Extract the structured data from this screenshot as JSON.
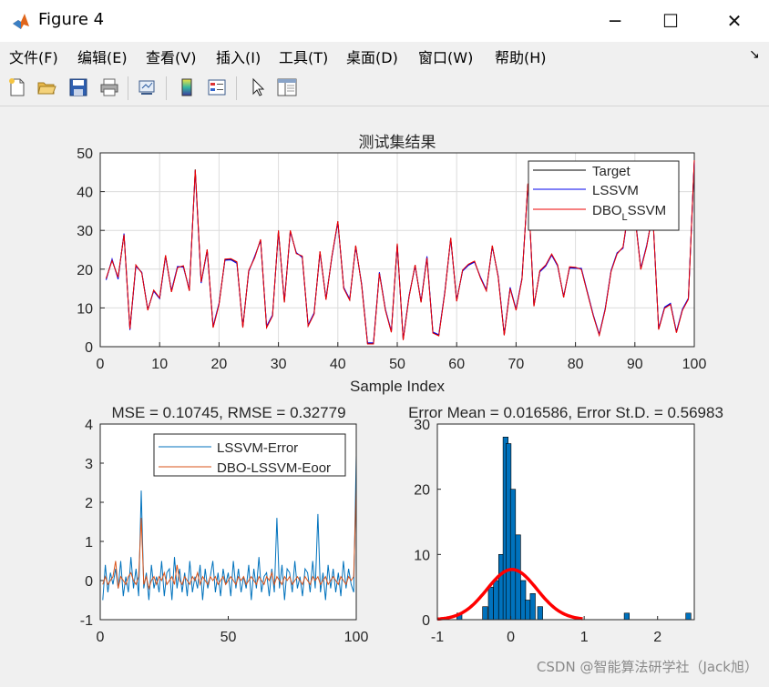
{
  "window": {
    "title": "Figure 4",
    "minimize_glyph": "─",
    "maximize_glyph": "☐",
    "close_glyph": "✕"
  },
  "menu": {
    "items": [
      "文件(F)",
      "编辑(E)",
      "查看(V)",
      "插入(I)",
      "工具(T)",
      "桌面(D)",
      "窗口(W)",
      "帮助(H)"
    ],
    "overflow_glyph": "↘"
  },
  "toolbar": {
    "icons": [
      "new-figure-icon",
      "open-file-icon",
      "save-icon",
      "print-icon",
      "link-plot-icon",
      "insert-colorbar-icon",
      "insert-legend-icon",
      "edit-plot-arrow-icon",
      "property-inspector-icon"
    ]
  },
  "watermark": "CSDN @智能算法研学社（Jack旭）",
  "chart_data": [
    {
      "type": "line",
      "title": "测试集结果",
      "xlabel": "Sample Index",
      "ylabel": "",
      "xlim": [
        0,
        100
      ],
      "ylim": [
        0,
        50
      ],
      "xticks": [
        "0",
        "10",
        "20",
        "30",
        "40",
        "50",
        "60",
        "70",
        "80",
        "90",
        "100"
      ],
      "yticks": [
        "0",
        "10",
        "20",
        "30",
        "40",
        "50"
      ],
      "grid": true,
      "legend_position": "top-right",
      "x": [
        1,
        2,
        3,
        4,
        5,
        6,
        7,
        8,
        9,
        10,
        11,
        12,
        13,
        14,
        15,
        16,
        17,
        18,
        19,
        20,
        21,
        22,
        23,
        24,
        25,
        26,
        27,
        28,
        29,
        30,
        31,
        32,
        33,
        34,
        35,
        36,
        37,
        38,
        39,
        40,
        41,
        42,
        43,
        44,
        45,
        46,
        47,
        48,
        49,
        50,
        51,
        52,
        53,
        54,
        55,
        56,
        57,
        58,
        59,
        60,
        61,
        62,
        63,
        64,
        65,
        66,
        67,
        68,
        69,
        70,
        71,
        72,
        73,
        74,
        75,
        76,
        77,
        78,
        79,
        80,
        81,
        82,
        83,
        84,
        85,
        86,
        87,
        88,
        89,
        90,
        91,
        92,
        93,
        94,
        95,
        96,
        97,
        98,
        99,
        100
      ],
      "series": [
        {
          "name": "Target",
          "color": "#000000",
          "values": [
            17.5,
            22.3,
            17.8,
            29,
            4.5,
            21,
            19.1,
            9.5,
            14.5,
            12.5,
            23.5,
            14.2,
            20.5,
            20.8,
            14.5,
            45.7,
            16.6,
            25,
            5,
            11,
            22.5,
            22.6,
            21.8,
            5,
            19.6,
            23,
            27.6,
            5,
            8,
            29.9,
            11.5,
            29.9,
            24.1,
            23.3,
            5.4,
            8.5,
            24.5,
            12.2,
            23.3,
            32.3,
            15.1,
            12.1,
            26,
            16,
            0.8,
            0.8,
            19,
            9.5,
            3.8,
            26.5,
            1.8,
            13,
            21,
            11.5,
            23,
            3.6,
            2.9,
            14,
            28,
            11.8,
            19.7,
            21.2,
            22,
            17.8,
            14.5,
            26,
            18,
            3,
            15.1,
            9.5,
            17.5,
            42,
            10.5,
            19.5,
            21,
            23.8,
            21,
            12.8,
            20.5,
            20.4,
            20,
            14,
            8,
            3,
            9.6,
            19.5,
            24,
            25.6,
            36,
            34,
            20,
            26,
            34.5,
            4.5,
            10,
            11,
            3.7,
            9.5,
            12.3,
            48
          ]
        },
        {
          "name": "LSSVM",
          "color": "#0000ee",
          "values": [
            17.2,
            22.6,
            17.4,
            29.2,
            4.3,
            20.7,
            19.2,
            9.6,
            14.3,
            12.4,
            23.2,
            14.5,
            20.7,
            20.5,
            14.8,
            45.3,
            16.4,
            24.8,
            5.3,
            11.2,
            22.3,
            22.4,
            21.5,
            5.2,
            19.4,
            23.3,
            27.4,
            5.3,
            8.2,
            29.6,
            11.8,
            29.6,
            24.3,
            23,
            5.6,
            8.7,
            24.2,
            12.5,
            23.1,
            32.1,
            15.3,
            12.3,
            25.7,
            16.2,
            1,
            1,
            19.2,
            9.7,
            4,
            26.2,
            2,
            13.2,
            20.8,
            11.7,
            23.3,
            3.8,
            3.1,
            14.2,
            27.8,
            12,
            19.5,
            21,
            21.8,
            18,
            14.7,
            25.8,
            18.2,
            3.2,
            15.3,
            9.7,
            17.7,
            41.7,
            10.7,
            19.3,
            20.8,
            23.6,
            20.8,
            13,
            20.3,
            20.2,
            20.2,
            14.2,
            8.2,
            3.2,
            9.8,
            19.7,
            24.2,
            25.4,
            35.8,
            34.2,
            20.2,
            26.2,
            34.3,
            4.7,
            10.2,
            11.2,
            3.9,
            9.7,
            12.5,
            47.7
          ]
        },
        {
          "name": "DBO_LSSVM",
          "color": "#ee0000",
          "values": [
            17.6,
            22.2,
            17.9,
            28.9,
            4.6,
            21.1,
            19,
            9.4,
            14.6,
            12.6,
            23.6,
            14.1,
            20.4,
            20.9,
            14.4,
            45.6,
            16.7,
            25.1,
            4.9,
            10.9,
            22.6,
            22.7,
            21.9,
            4.9,
            19.7,
            22.9,
            27.7,
            4.9,
            7.9,
            30,
            11.4,
            30,
            24,
            23.4,
            5.3,
            8.4,
            24.6,
            12.1,
            23.4,
            32.4,
            15,
            12,
            26.1,
            15.9,
            0.7,
            0.7,
            18.9,
            9.4,
            3.7,
            26.6,
            1.7,
            12.9,
            21.1,
            11.4,
            22.9,
            3.5,
            2.8,
            13.9,
            28.1,
            11.7,
            19.8,
            21.3,
            22.1,
            17.7,
            14.4,
            26.1,
            17.9,
            2.9,
            15,
            9.4,
            17.4,
            42.1,
            10.4,
            19.6,
            21.1,
            23.9,
            21.1,
            12.7,
            20.6,
            20.5,
            19.9,
            13.9,
            7.9,
            2.9,
            9.5,
            19.4,
            23.9,
            25.7,
            36.1,
            33.9,
            19.9,
            25.9,
            34.6,
            4.4,
            9.9,
            10.9,
            3.6,
            9.4,
            12.2,
            48.1
          ]
        }
      ],
      "legend_label_main": "DBO",
      "legend_label_sub": "L",
      "legend_label_rest": "SSVM"
    },
    {
      "type": "line",
      "title": "MSE = 0.10745, RMSE = 0.32779",
      "xlabel": "",
      "ylabel": "",
      "xlim": [
        0,
        100
      ],
      "ylim": [
        -1,
        4
      ],
      "xticks": [
        "0",
        "50",
        "100"
      ],
      "yticks": [
        "-1",
        "0",
        "1",
        "2",
        "3",
        "4"
      ],
      "grid": false,
      "legend_position": "top-right",
      "x": [
        1,
        2,
        3,
        4,
        5,
        6,
        7,
        8,
        9,
        10,
        11,
        12,
        13,
        14,
        15,
        16,
        17,
        18,
        19,
        20,
        21,
        22,
        23,
        24,
        25,
        26,
        27,
        28,
        29,
        30,
        31,
        32,
        33,
        34,
        35,
        36,
        37,
        38,
        39,
        40,
        41,
        42,
        43,
        44,
        45,
        46,
        47,
        48,
        49,
        50,
        51,
        52,
        53,
        54,
        55,
        56,
        57,
        58,
        59,
        60,
        61,
        62,
        63,
        64,
        65,
        66,
        67,
        68,
        69,
        70,
        71,
        72,
        73,
        74,
        75,
        76,
        77,
        78,
        79,
        80,
        81,
        82,
        83,
        84,
        85,
        86,
        87,
        88,
        89,
        90,
        91,
        92,
        93,
        94,
        95,
        96,
        97,
        98,
        99,
        100
      ],
      "series": [
        {
          "name": "LSSVM-Error",
          "color": "#0072bd",
          "values": [
            -0.5,
            0.4,
            -0.3,
            0.2,
            -0.1,
            0.3,
            -0.2,
            0.5,
            -0.4,
            0.1,
            -0.3,
            0.6,
            -0.2,
            0.3,
            -0.4,
            2.3,
            -0.2,
            0.2,
            -0.5,
            0.4,
            -0.2,
            0.1,
            -0.3,
            0.5,
            -0.4,
            0.2,
            0.3,
            -0.5,
            0.6,
            -0.2,
            0.3,
            -0.3,
            0.2,
            -0.4,
            0.5,
            -0.3,
            0.1,
            -0.2,
            0.4,
            -0.5,
            0.3,
            -0.2,
            0.1,
            0.5,
            -0.3,
            0.2,
            -0.4,
            0.3,
            -0.1,
            0.2,
            -0.4,
            0.5,
            -0.2,
            0.3,
            -0.3,
            0.1,
            -0.2,
            0.4,
            -0.5,
            0.3,
            -0.2,
            0.6,
            -0.3,
            0.1,
            0.2,
            -0.4,
            0.3,
            -0.3,
            1.6,
            -0.2,
            0.4,
            -0.5,
            0.3,
            0.2,
            -0.3,
            0.5,
            -0.2,
            0.1,
            -0.4,
            0.3,
            0.2,
            -0.3,
            0.5,
            -0.2,
            1.7,
            -0.3,
            0.2,
            -0.5,
            0.4,
            -0.2,
            0.3,
            -0.3,
            0.2,
            -0.4,
            0.5,
            -0.2,
            0.3,
            -0.1,
            -0.3,
            3.2
          ]
        },
        {
          "name": "DBO-LSSVM-Eoor",
          "color": "#d95319",
          "values": [
            -0.1,
            0.1,
            -0.1,
            0,
            0.1,
            0.5,
            -0.2,
            0.1,
            0,
            -0.1,
            0.1,
            0.2,
            0,
            -0.1,
            0.1,
            1.6,
            -0.1,
            0.1,
            -0.2,
            0,
            0.1,
            -0.1,
            0.1,
            0,
            0.2,
            -0.1,
            0,
            0.1,
            -0.1,
            0.4,
            0,
            -0.1,
            0.1,
            0,
            -0.1,
            0.1,
            0,
            0.2,
            -0.1,
            0.1,
            0,
            -0.1,
            0.1,
            0,
            0.1,
            -0.1,
            0,
            0.1,
            -0.1,
            0,
            0.1,
            0,
            -0.1,
            0.1,
            0,
            0.1,
            -0.1,
            0,
            0.1,
            0,
            -0.1,
            0.1,
            0,
            -0.1,
            0.1,
            0,
            0.2,
            -0.1,
            0.1,
            0,
            -0.1,
            0.1,
            0,
            0.1,
            -0.1,
            0,
            0.1,
            0,
            -0.1,
            0.1,
            0,
            -0.1,
            0.1,
            0,
            0.1,
            -0.1,
            0,
            0.1,
            -0.1,
            0,
            0.1,
            0,
            -0.1,
            0.1,
            0,
            -0.1,
            0.1,
            0,
            0.1,
            2.4
          ]
        }
      ]
    },
    {
      "type": "bar",
      "title": "Error Mean = 0.016586, Error St.D. = 0.56983",
      "xlabel": "",
      "ylabel": "",
      "xlim": [
        -1,
        2.5
      ],
      "ylim": [
        0,
        30
      ],
      "xticks": [
        "-1",
        "0",
        "1",
        "2"
      ],
      "yticks": [
        "0",
        "10",
        "20",
        "30"
      ],
      "grid": false,
      "bin_centers": [
        -0.9,
        -0.7,
        -0.35,
        -0.27,
        -0.2,
        -0.13,
        -0.07,
        -0.03,
        0.03,
        0.1,
        0.17,
        0.23,
        0.3,
        0.4,
        1.58,
        2.42
      ],
      "bin_counts": [
        0.3,
        1,
        2,
        5,
        6,
        10,
        28,
        27,
        20,
        13,
        6,
        3,
        4,
        2,
        1,
        1
      ],
      "bar_color": "#0072bd",
      "fit_curve_color": "#ff0000",
      "fit_curve_peak": 7.7,
      "fit_mean": 0.016586,
      "fit_std": 0.56983
    }
  ]
}
